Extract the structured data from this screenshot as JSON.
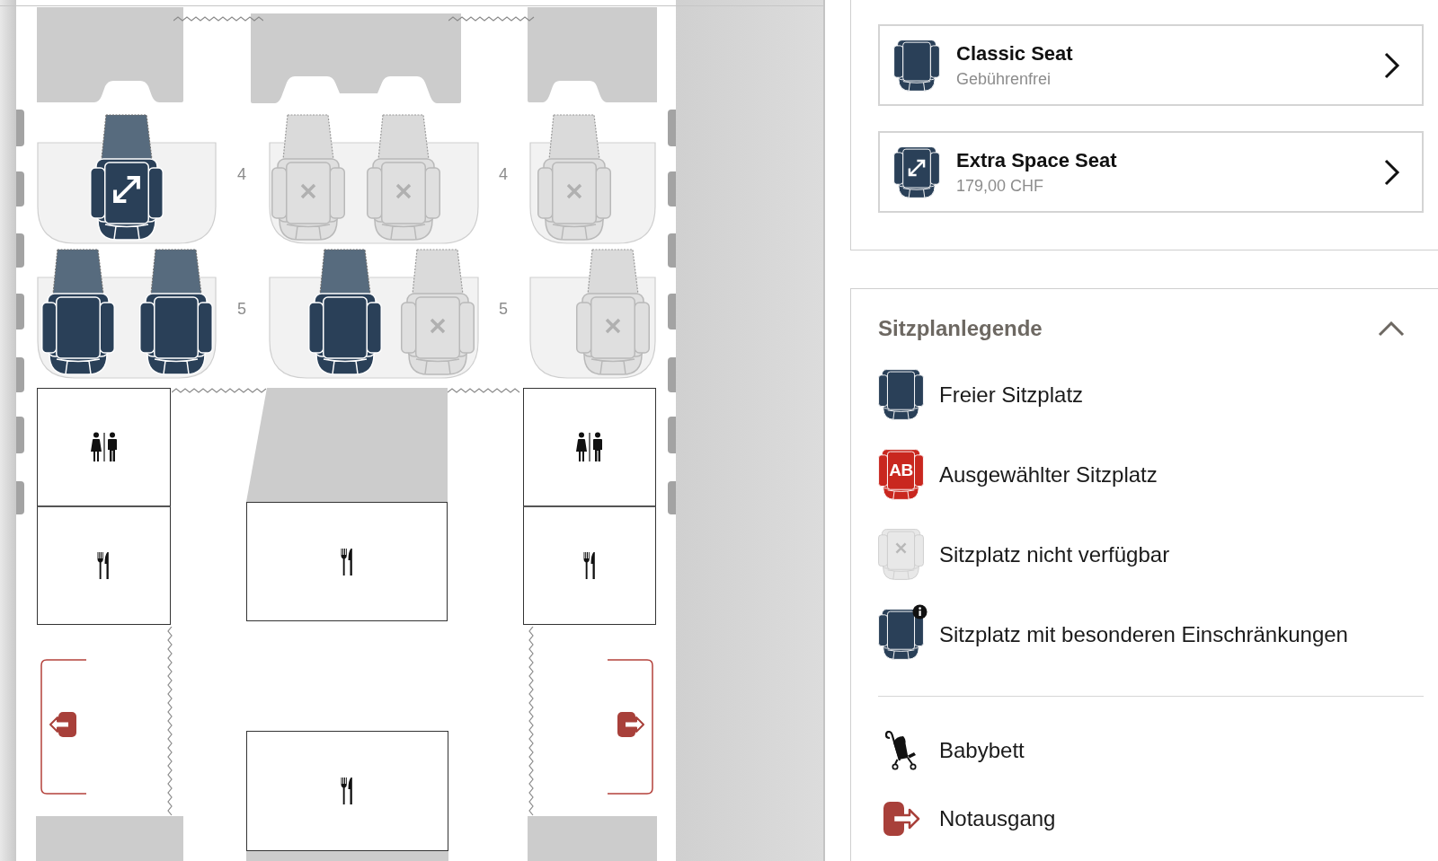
{
  "seat_map": {
    "rows": [
      {
        "labels": [
          "4",
          "4"
        ],
        "sections": [
          {
            "seats": [
              {
                "available": true,
                "extra_space": true
              }
            ]
          },
          {
            "seats": [
              {
                "available": false,
                "extra_space": false
              },
              {
                "available": false,
                "extra_space": false
              }
            ]
          },
          {
            "seats": [
              {
                "available": false,
                "extra_space": false
              }
            ]
          }
        ]
      },
      {
        "labels": [
          "5",
          "5"
        ],
        "sections": [
          {
            "seats": [
              {
                "available": true,
                "extra_space": false
              },
              {
                "available": true,
                "extra_space": false
              }
            ]
          },
          {
            "seats": [
              {
                "available": true,
                "extra_space": false
              },
              {
                "available": false,
                "extra_space": false
              }
            ]
          },
          {
            "seats": [
              {
                "available": false,
                "extra_space": false
              }
            ]
          }
        ]
      }
    ]
  },
  "seat_options": [
    {
      "kind": "classic",
      "title": "Classic Seat",
      "price": "Gebührenfrei"
    },
    {
      "kind": "extra_space",
      "title": "Extra Space Seat",
      "price": "179,00 CHF"
    }
  ],
  "legend": {
    "title": "Sitzplanlegende",
    "expanded": true,
    "seat_items": [
      {
        "kind": "free",
        "label": "Freier Sitzplatz"
      },
      {
        "kind": "selected",
        "label": "Ausgewählter Sitzplatz",
        "seat_text": "AB"
      },
      {
        "kind": "unavailable",
        "label": "Sitzplatz nicht verfügbar"
      },
      {
        "kind": "restricted",
        "label": "Sitzplatz mit besonderen Einschränkungen"
      }
    ],
    "facility_items": [
      {
        "kind": "bassinet",
        "label": "Babybett"
      },
      {
        "kind": "exit",
        "label": "Notausgang"
      }
    ]
  }
}
